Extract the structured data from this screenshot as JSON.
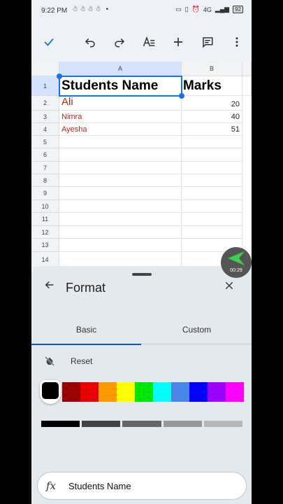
{
  "status": {
    "time": "9:22 PM",
    "left_icons": "☃☃☃☃ •",
    "network": "4G",
    "battery": "92"
  },
  "toolbar": {
    "done_icon": "check-icon",
    "undo_icon": "undo-icon",
    "redo_icon": "redo-icon",
    "format_icon": "text-format-icon",
    "insert_icon": "plus-icon",
    "comment_icon": "comment-icon",
    "more_icon": "more-vert-icon"
  },
  "sheet": {
    "columns": [
      "A",
      "B"
    ],
    "rows": [
      "1",
      "2",
      "3",
      "4",
      "5",
      "6",
      "7",
      "8",
      "9",
      "10",
      "11",
      "12",
      "13",
      "14"
    ],
    "cells": {
      "a1": "Students Name",
      "b1": "Marks",
      "a2": "Ali",
      "b2": "20",
      "a3": "Nimra",
      "b3": "40",
      "a4": "Ayesha",
      "b4": "51"
    }
  },
  "panel": {
    "title": "Format",
    "tabs": [
      {
        "label": "Basic"
      },
      {
        "label": "Custom"
      }
    ],
    "reset_label": "Reset",
    "colors": [
      "#000000",
      "#990000",
      "#e60000",
      "#ff9900",
      "#ffff00",
      "#00e600",
      "#00ffff",
      "#4a86e8",
      "#0000ff",
      "#9900ff",
      "#ff00ff"
    ],
    "grays": [
      "#000000",
      "#434343",
      "#666666",
      "#999999",
      "#b7b7b7"
    ]
  },
  "formula_bar": {
    "value": "Students Name"
  },
  "recorder": {
    "time": "00:29"
  },
  "accent": "#1a73e8"
}
